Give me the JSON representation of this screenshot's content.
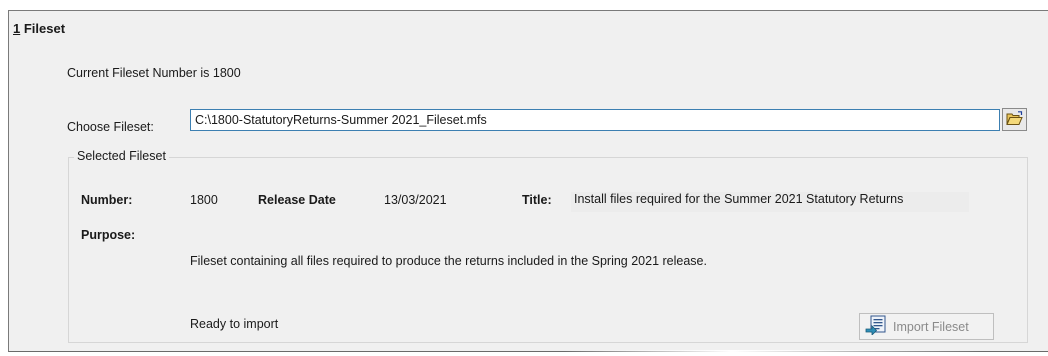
{
  "section": {
    "number": "1",
    "title": " Fileset"
  },
  "current_fileset_text": "Current Fileset Number is 1800",
  "choose": {
    "label": "Choose Fileset:",
    "value": "C:\\1800-StatutoryReturns-Summer 2021_Fileset.mfs",
    "browse_icon": "open-folder-icon"
  },
  "selected_fileset": {
    "legend": "Selected Fileset",
    "number_label": "Number:",
    "number_value": "1800",
    "release_label": "Release Date",
    "release_value": "13/03/2021",
    "title_label": "Title:",
    "title_value": "Install files required for the Summer 2021 Statutory Returns",
    "purpose_label": "Purpose:",
    "purpose_value": "Fileset containing all files required to produce the returns included in the Spring 2021 release.",
    "status": "Ready to import",
    "import_button": "Import Fileset",
    "import_icon": "import-fileset-icon"
  }
}
